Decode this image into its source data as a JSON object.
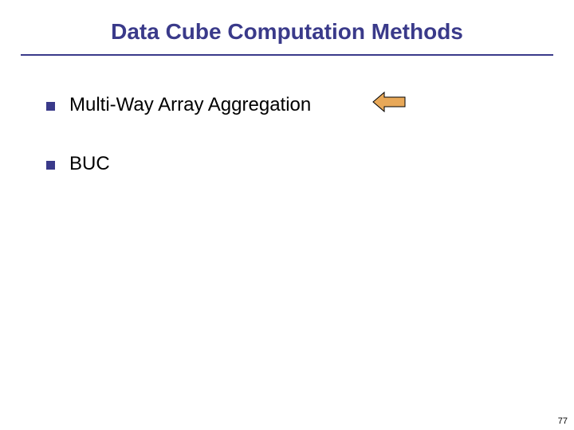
{
  "title": "Data Cube Computation Methods",
  "bullets": [
    {
      "text": "Multi-Way Array Aggregation",
      "has_arrow": true
    },
    {
      "text": "BUC",
      "has_arrow": false
    }
  ],
  "page_number": "77"
}
